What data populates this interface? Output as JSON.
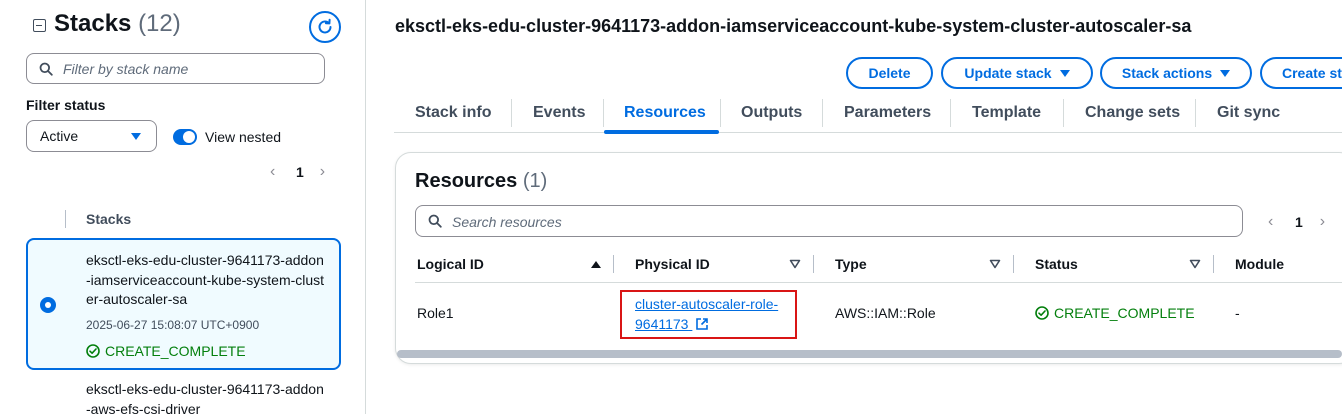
{
  "left_panel": {
    "title": "Stacks",
    "count": "(12)",
    "filter_placeholder": "Filter by stack name",
    "filter_status_label": "Filter status",
    "filter_status_value": "Active",
    "view_nested_label": "View nested",
    "view_nested_on": true,
    "page_number": "1",
    "column_header": "Stacks",
    "stacks": [
      {
        "name": "eksctl-eks-edu-cluster-9641173-addon-iamserviceaccount-kube-system-cluster-autoscaler-sa",
        "date": "2025-06-27 15:08:07 UTC+0900",
        "status": "CREATE_COMPLETE",
        "selected": true
      },
      {
        "name": "eksctl-eks-edu-cluster-9641173-addon-aws-efs-csi-driver"
      }
    ]
  },
  "main": {
    "page_title": "eksctl-eks-edu-cluster-9641173-addon-iamserviceaccount-kube-system-cluster-autoscaler-sa",
    "actions": {
      "delete": "Delete",
      "update_stack": "Update stack",
      "stack_actions": "Stack actions",
      "create_stack": "Create stack"
    },
    "tabs": [
      "Stack info",
      "Events",
      "Resources",
      "Outputs",
      "Parameters",
      "Template",
      "Change sets",
      "Git sync"
    ],
    "active_tab": "Resources",
    "resources": {
      "title": "Resources",
      "count": "(1)",
      "search_placeholder": "Search resources",
      "page_number": "1",
      "columns": [
        "Logical ID",
        "Physical ID",
        "Type",
        "Status",
        "Module"
      ],
      "rows": [
        {
          "logical_id": "Role1",
          "physical_id_line1": "cluster-autoscaler-role-",
          "physical_id_line2": "9641173",
          "type": "AWS::IAM::Role",
          "status": "CREATE_COMPLETE",
          "module": "-"
        }
      ]
    }
  },
  "colors": {
    "accent": "#006ce0",
    "success": "#037f0c",
    "highlight_box": "#d91515"
  }
}
